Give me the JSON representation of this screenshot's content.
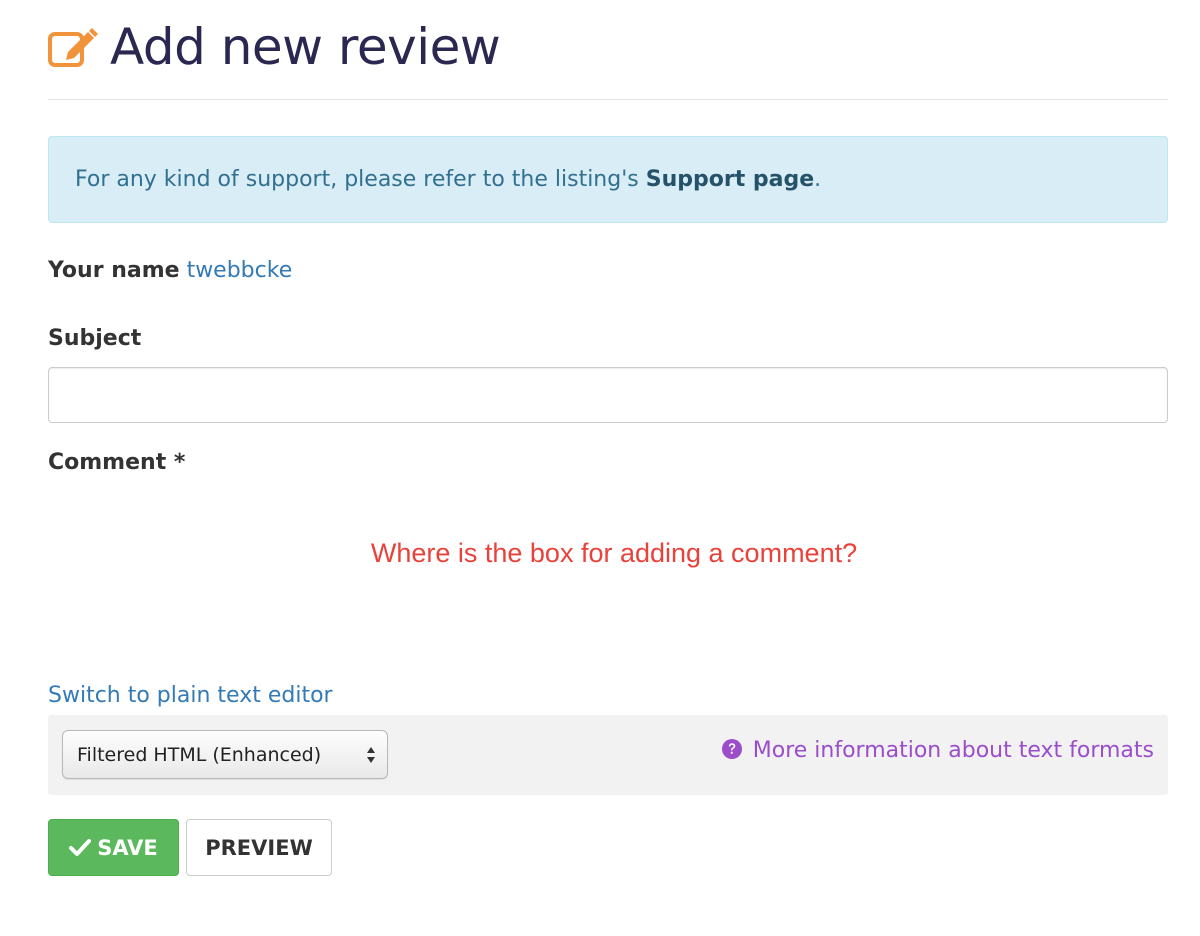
{
  "header": {
    "title": "Add new review",
    "icon": "edit-icon"
  },
  "alert": {
    "text_before": "For any kind of support, please refer to the listing's ",
    "link_text": "Support page",
    "text_after": "."
  },
  "form": {
    "name_label": "Your name",
    "name_value": "twebbcke",
    "subject_label": "Subject",
    "subject_value": "",
    "comment_label": "Comment *",
    "annotation": "Where is the box for adding a comment?",
    "switch_editor_link": "Switch to plain text editor",
    "text_format": {
      "selected": "Filtered HTML (Enhanced)",
      "help_icon": "question-circle-icon",
      "more_info_link": "More information about text formats"
    }
  },
  "actions": {
    "save_label": "SAVE",
    "save_icon": "check-icon",
    "preview_label": "PREVIEW"
  },
  "colors": {
    "title": "#2a2750",
    "icon_accent": "#f0933a",
    "alert_bg": "#d9edf7",
    "alert_text": "#31708f",
    "link": "#337ab7",
    "annotation": "#e8423a",
    "more_info": "#9b4dca",
    "save_bg": "#5cb85c"
  }
}
